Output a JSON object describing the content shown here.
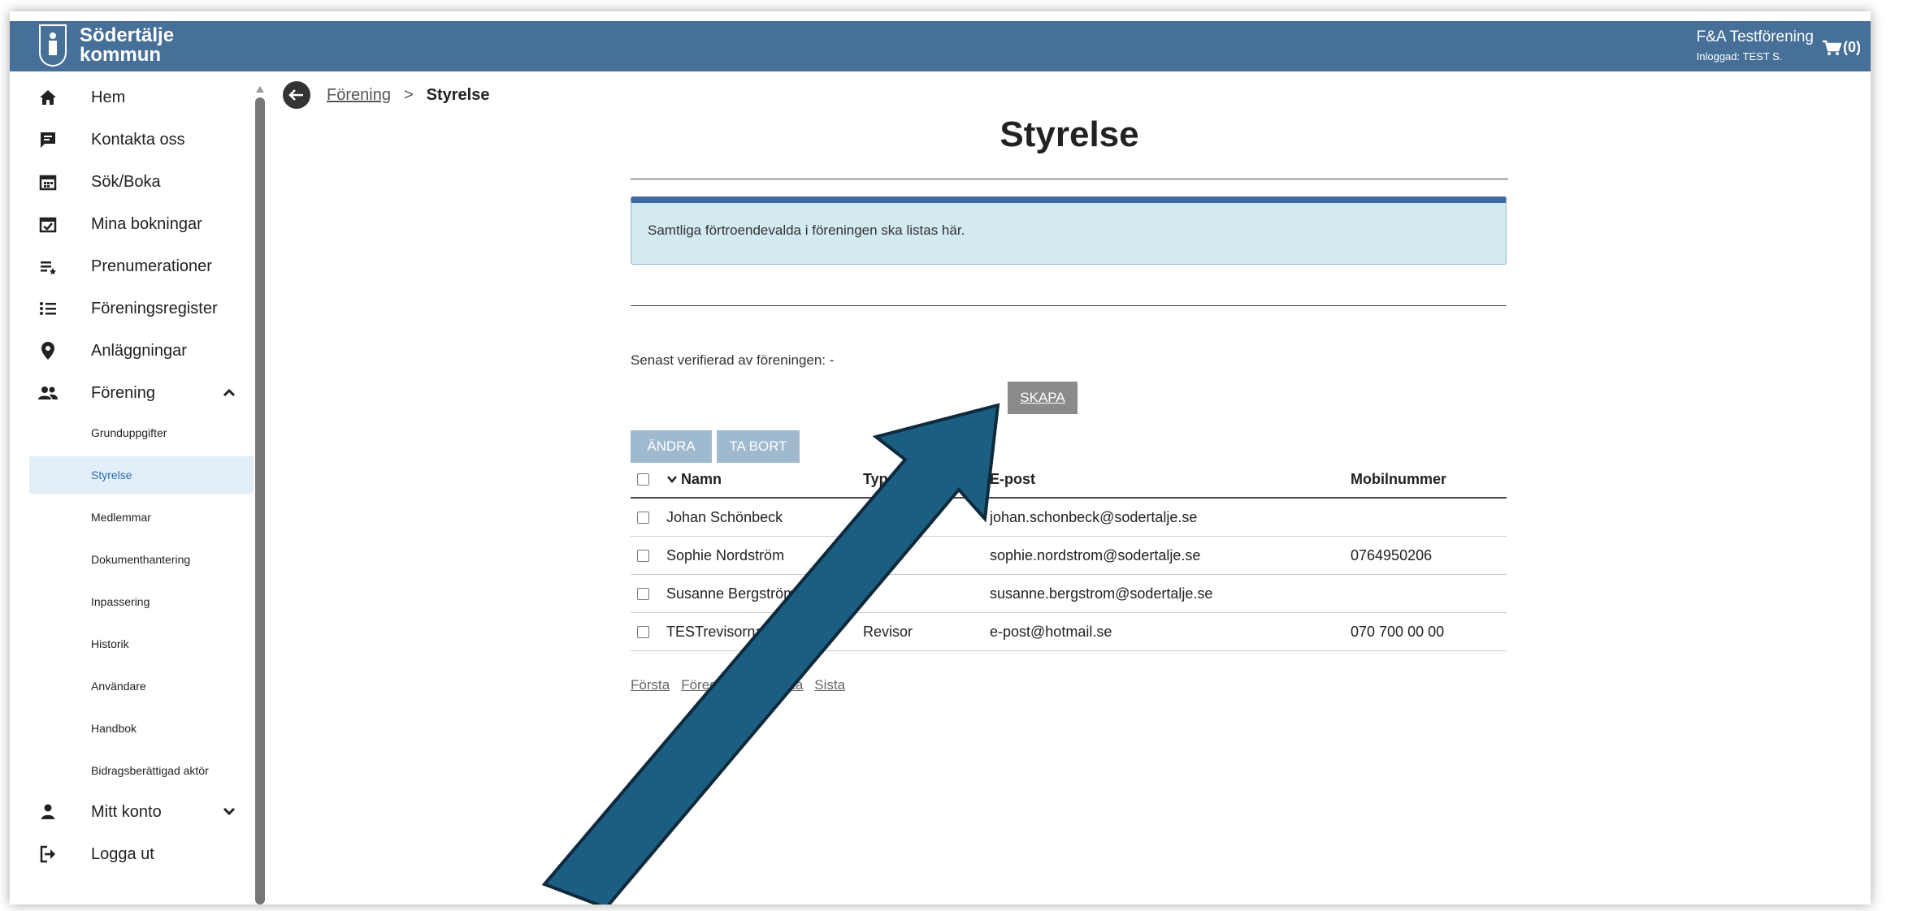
{
  "header": {
    "logo_line1": "Södertälje",
    "logo_line2": "kommun",
    "org_name": "F&A Testförening",
    "logged_in": "Inloggad: TEST S.",
    "cart_count": "(0)"
  },
  "sidebar": {
    "items": [
      {
        "label": "Hem",
        "icon": "home-icon"
      },
      {
        "label": "Kontakta oss",
        "icon": "chat-icon"
      },
      {
        "label": "Sök/Boka",
        "icon": "calendar-icon"
      },
      {
        "label": "Mina bokningar",
        "icon": "calendar-check-icon"
      },
      {
        "label": "Prenumerationer",
        "icon": "subscription-list-icon"
      },
      {
        "label": "Föreningsregister",
        "icon": "list-icon"
      },
      {
        "label": "Anläggningar",
        "icon": "location-pin-icon"
      },
      {
        "label": "Förening",
        "icon": "people-icon"
      }
    ],
    "sub_items": [
      "Grunduppgifter",
      "Styrelse",
      "Medlemmar",
      "Dokumenthantering",
      "Inpassering",
      "Historik",
      "Användare",
      "Handbok",
      "Bidragsberättigad aktör"
    ],
    "active_sub_item": "Styrelse",
    "account": {
      "label": "Mitt konto",
      "icon": "person-icon"
    },
    "logout": {
      "label": "Logga ut",
      "icon": "logout-icon"
    }
  },
  "breadcrumb": {
    "parent": "Förening",
    "separator": ">",
    "current": "Styrelse"
  },
  "main": {
    "title": "Styrelse",
    "info": "Samtliga förtroendevalda i föreningen ska listas här.",
    "verified": "Senast verifierad av föreningen: -",
    "create_label": "SKAPA",
    "edit_label": "ÄNDRA",
    "delete_label": "TA BORT"
  },
  "table": {
    "columns": {
      "name": "Namn",
      "type": "Typ",
      "email": "E-post",
      "mobile": "Mobilnummer"
    },
    "rows": [
      {
        "name": "Johan Schönbeck",
        "type": "",
        "email": "johan.schonbeck@sodertalje.se",
        "mobile": ""
      },
      {
        "name": "Sophie Nordström",
        "type": "",
        "email": "sophie.nordstrom@sodertalje.se",
        "mobile": "0764950206"
      },
      {
        "name": "Susanne Bergström",
        "type": "",
        "email": "susanne.bergstrom@sodertalje.se",
        "mobile": ""
      },
      {
        "name": "TESTrevisorna",
        "type": "Revisor",
        "email": "e-post@hotmail.se",
        "mobile": "070 700 00 00"
      }
    ]
  },
  "pager": {
    "first": "Första",
    "prev": "Föregående",
    "next": "Nästa",
    "last": "Sista"
  },
  "colors": {
    "header": "#477099",
    "arrow": "#1b5e82",
    "info_bg": "#d2eaf0",
    "button": "#9fb9cf",
    "create_button": "#8a8a8a"
  }
}
